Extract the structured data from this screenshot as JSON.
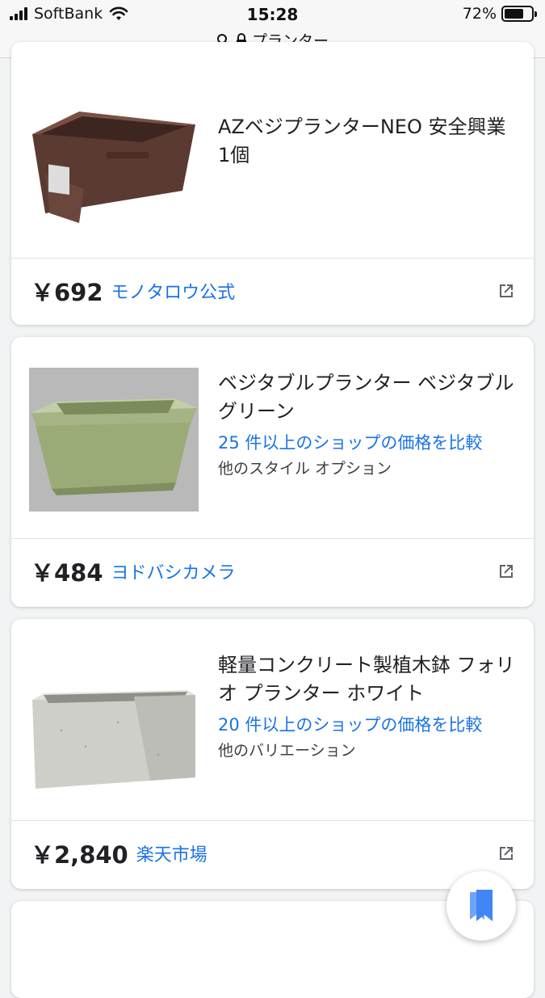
{
  "status_bar": {
    "carrier": "SoftBank",
    "time": "15:28",
    "battery_percent_label": "72%",
    "battery_level": 0.72,
    "url_text": "プランター"
  },
  "products": [
    {
      "title": "AZベジプランターNEO 安全興業 1個",
      "compare_text": "",
      "variant_text": "",
      "price": "￥692",
      "seller": "モノタロウ公式",
      "image_icon": "brown-planter-image"
    },
    {
      "title": "ベジタブルプランター ベジタブルグリーン",
      "compare_text": "25 件以上のショップの価格を比較",
      "variant_text": "他のスタイル オプション",
      "price": "￥484",
      "seller": "ヨドバシカメラ",
      "image_icon": "green-planter-image"
    },
    {
      "title": "軽量コンクリート製植木鉢 フォリオ プランター ホワイト",
      "compare_text": "20 件以上のショップの価格を比較",
      "variant_text": "他のバリエーション",
      "price": "￥2,840",
      "seller": "楽天市場",
      "image_icon": "concrete-planter-image"
    }
  ],
  "colors": {
    "link_blue": "#1a73e8",
    "background": "#f1f3f4",
    "fab_icon_blue": "#4285f4"
  },
  "fab": {
    "icon": "bookmark-stack-icon"
  }
}
